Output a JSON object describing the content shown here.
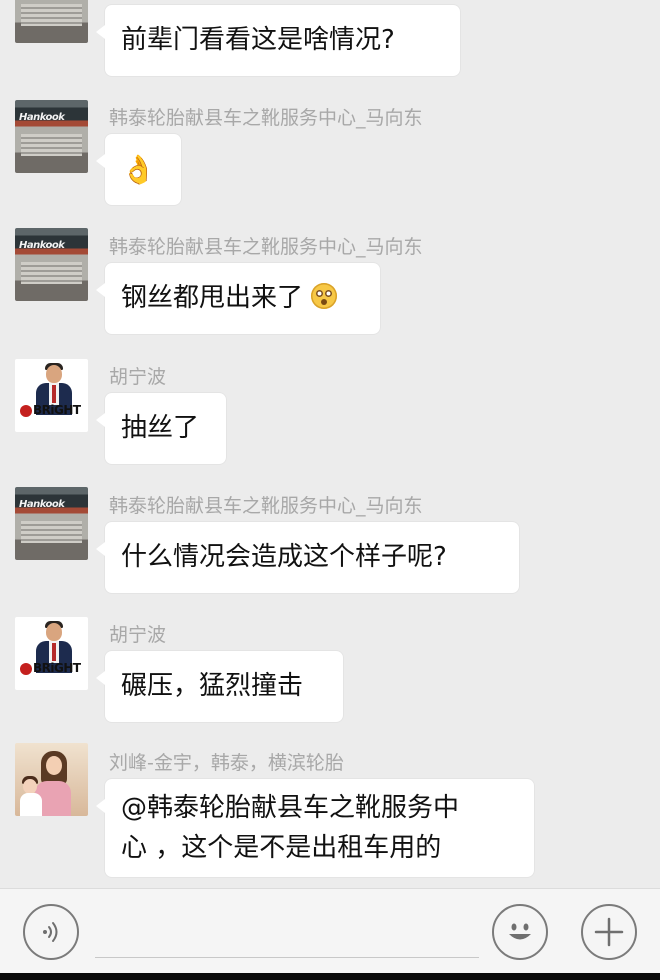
{
  "messages": [
    {
      "id": "m1",
      "sender": "",
      "avatar": "hankook-store-avatar",
      "text": "前辈门看看这是啥情况?"
    },
    {
      "id": "m2",
      "sender": "韩泰轮胎献县车之靴服务中心_马向东",
      "avatar": "hankook-store-avatar",
      "emoji": "👌"
    },
    {
      "id": "m3",
      "sender": "韩泰轮胎献县车之靴服务中心_马向东",
      "avatar": "hankook-store-avatar",
      "text": "钢丝都甩出来了",
      "emoji": "surprised-face"
    },
    {
      "id": "m4",
      "sender": "胡宁波",
      "avatar": "bright-logo-avatar",
      "text": "抽丝了"
    },
    {
      "id": "m5",
      "sender": "韩泰轮胎献县车之靴服务中心_马向东",
      "avatar": "hankook-store-avatar",
      "text": "什么情况会造成这个样子呢?"
    },
    {
      "id": "m6",
      "sender": "胡宁波",
      "avatar": "bright-logo-avatar",
      "text": "碾压，猛烈撞击"
    },
    {
      "id": "m7",
      "sender": "刘峰-金宇，韩泰，横滨轮胎",
      "avatar": "family-photo-avatar",
      "text_line1": "@韩泰轮胎献县车之靴服务中",
      "text_line2": "心 ，这个是不是出租车用的"
    }
  ],
  "avatar_labels": {
    "hankook": "Hankook",
    "bright": "BRiGHT"
  },
  "input_bar": {
    "placeholder": "",
    "voice_icon": "voice-icon",
    "emoji_icon": "smiley-icon",
    "plus_icon": "plus-icon"
  },
  "colors": {
    "background": "#ececec",
    "bubble": "#ffffff",
    "sender_text": "#a8a8a8",
    "icon_stroke": "#7b7b7b"
  }
}
